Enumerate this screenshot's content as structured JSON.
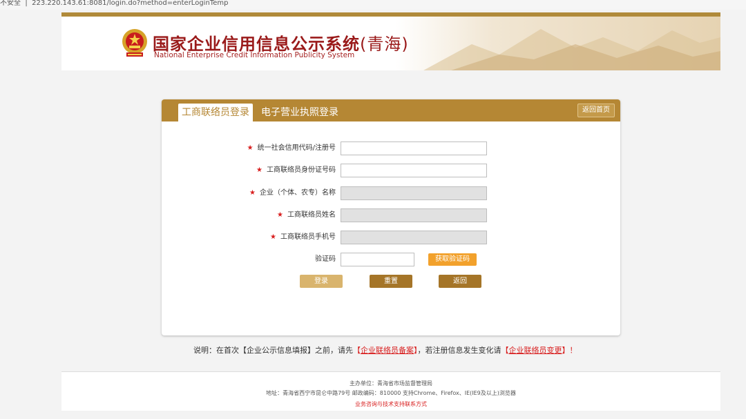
{
  "browser": {
    "security": "不安全",
    "url": "223.220.143.61:8081/login.do?method=enterLoginTemp"
  },
  "header": {
    "title_cn": "国家企业信用信息公示系统",
    "province": "(青海)",
    "title_en": "National Enterprise Credit Information Publicity System"
  },
  "tabs": {
    "active": "工商联络员登录",
    "other": "电子营业执照登录"
  },
  "back_home": "返回首页",
  "form": {
    "code_label": "统一社会信用代码/注册号",
    "code_value": "",
    "idcard_label": "工商联络员身份证号码",
    "idcard_value": "",
    "company_label": "企业（个体、农专）名称",
    "company_value": "",
    "name_label": "工商联络员姓名",
    "name_value": "",
    "phone_label": "工商联络员手机号",
    "phone_value": "",
    "captcha_label": "验证码",
    "captcha_value": "",
    "get_code": "获取验证码",
    "required_mark": "★"
  },
  "buttons": {
    "login": "登录",
    "reset": "重置",
    "back": "返回"
  },
  "note": {
    "prefix": "说明：在首次【企业公示信息填报】之前，请先",
    "bracket_open": "【",
    "link1": "企业联络员备案",
    "bracket_close": "】",
    "middle": "，若注册信息发生变化请",
    "link2": "企业联络员变更",
    "suffix": "！"
  },
  "footer": {
    "line1": "主办单位：青海省市场监督管理局",
    "line2": "地址：青海省西宁市昆仑中路79号    邮政编码：810000 支持Chrome、Firefox、IE(IE9及以上)浏览器",
    "line3": "业务咨询与技术支持联系方式"
  },
  "colors": {
    "accent": "#b58734",
    "title_red": "#9a1a1a",
    "link_red": "#d81e1e",
    "code_button": "#f2a12c"
  }
}
